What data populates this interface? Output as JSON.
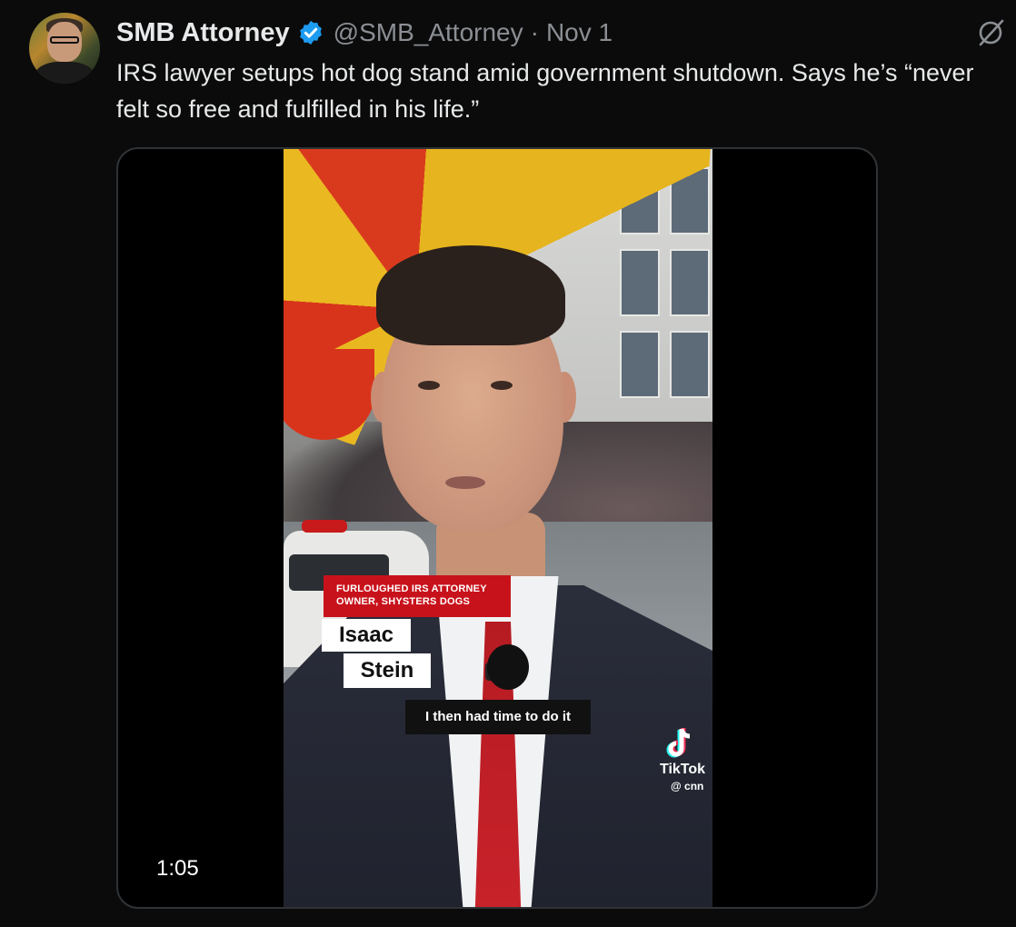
{
  "tweet": {
    "author_name": "SMB Attorney",
    "handle": "@SMB_Attorney",
    "separator": "·",
    "date": "Nov 1",
    "text": "IRS lawyer setups hot dog stand amid government shutdown. Says he’s “never felt so free and fulfilled in his life.”",
    "verified_color": "#1d9bf0"
  },
  "video": {
    "lower_third_line1": "FURLOUGHED IRS ATTORNEY",
    "lower_third_line2": "OWNER, SHYSTERS DOGS",
    "name_first": "Isaac",
    "name_last": "Stein",
    "caption": "I then had time to do it",
    "watermark_brand": "TikTok",
    "watermark_handle": "@ cnn",
    "duration": "1:05"
  },
  "icons": {
    "verified": "verified-badge-icon",
    "share": "slash-circle-icon",
    "tiktok": "tiktok-note-icon"
  }
}
